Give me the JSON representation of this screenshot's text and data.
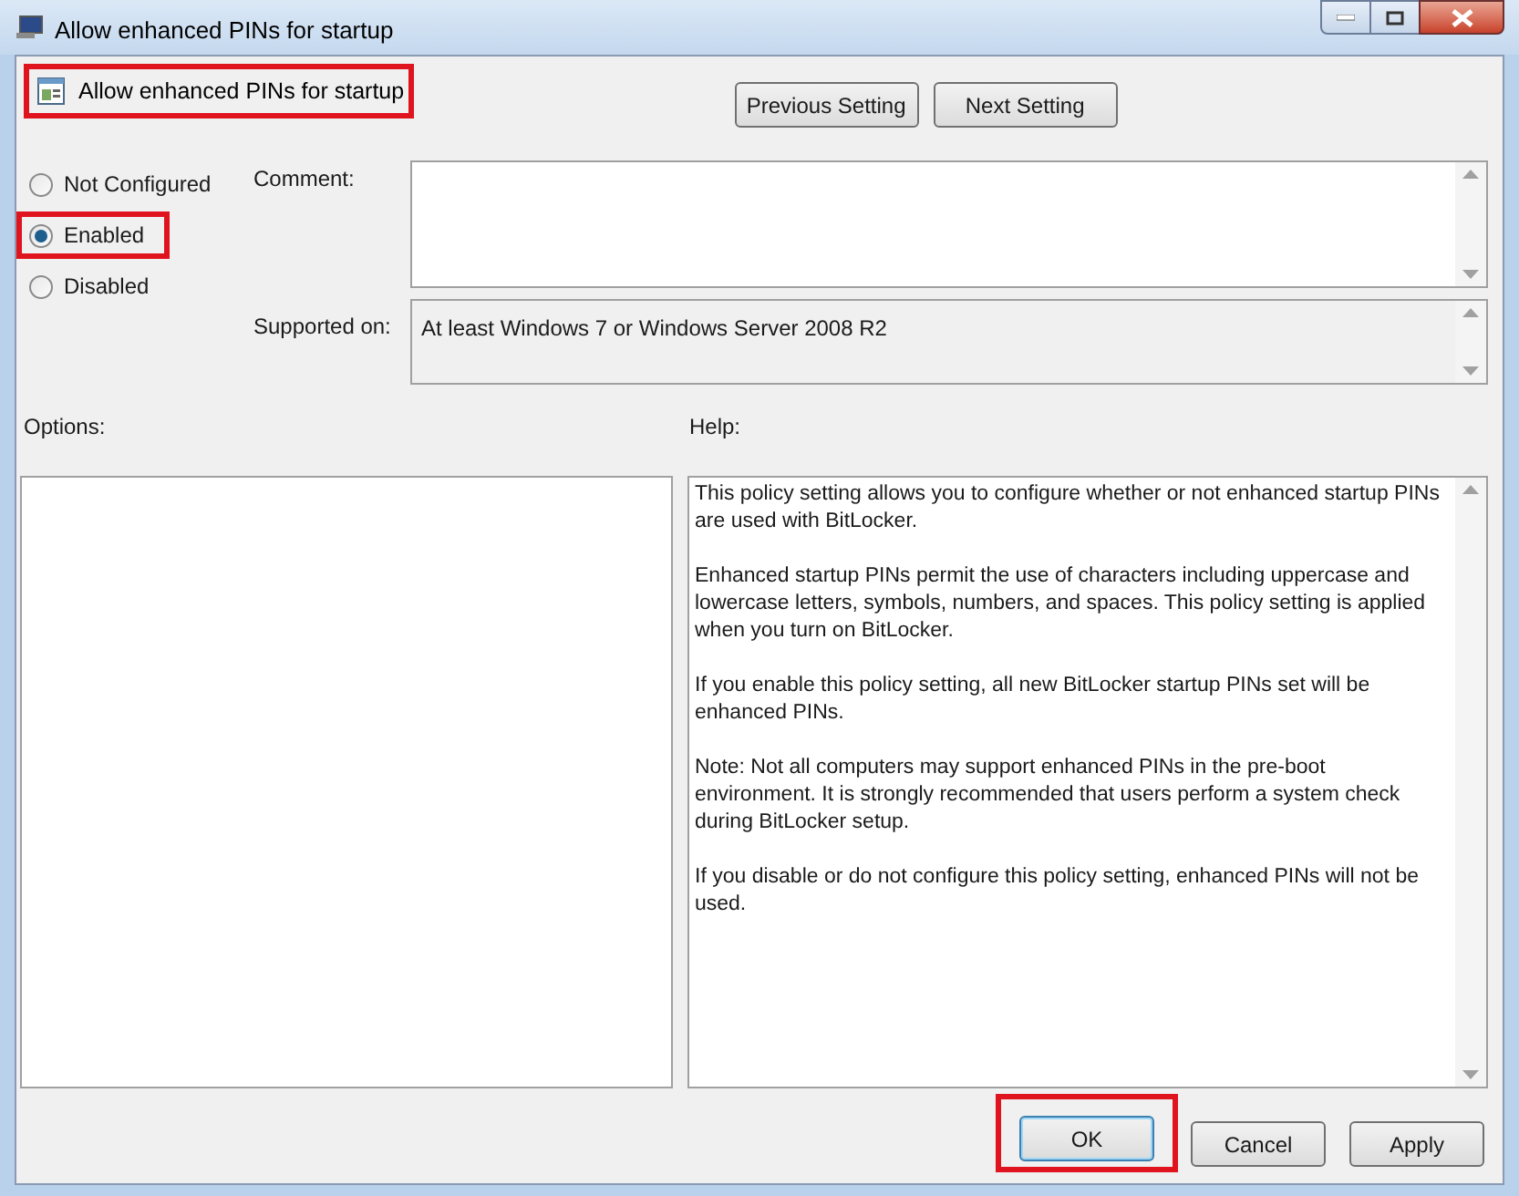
{
  "window": {
    "title": "Allow enhanced PINs for startup"
  },
  "heading": {
    "text": "Allow enhanced PINs for startup",
    "highlighted": true
  },
  "nav_buttons": [
    "Previous Setting",
    "Next Setting"
  ],
  "state_options": [
    {
      "label": "Not Configured",
      "selected": false,
      "highlighted": false
    },
    {
      "label": "Enabled",
      "selected": true,
      "highlighted": true
    },
    {
      "label": "Disabled",
      "selected": false,
      "highlighted": false
    }
  ],
  "comment": {
    "label": "Comment:"
  },
  "supported_on": {
    "label": "Supported on:",
    "value": "At least Windows 7 or Windows Server 2008 R2"
  },
  "options": {
    "label": "Options:"
  },
  "help": {
    "label": "Help:",
    "paragraphs": [
      "This policy setting allows you to configure whether or not enhanced startup PINs are used with BitLocker.",
      "Enhanced startup PINs permit the use of characters including uppercase and lowercase letters, symbols, numbers, and spaces. This policy setting is applied when you turn on BitLocker.",
      "If you enable this policy setting, all new BitLocker startup PINs set will be enhanced PINs.",
      "Note:   Not all computers may support enhanced PINs in the pre-boot environment. It is strongly recommended that users perform a system check during BitLocker setup.",
      "If you disable or do not configure this policy setting, enhanced PINs will not be used."
    ]
  },
  "buttons": [
    {
      "label": "OK",
      "default": true,
      "highlighted": true
    },
    {
      "label": "Cancel",
      "default": false,
      "highlighted": false
    },
    {
      "label": "Apply",
      "default": false,
      "highlighted": false
    }
  ]
}
